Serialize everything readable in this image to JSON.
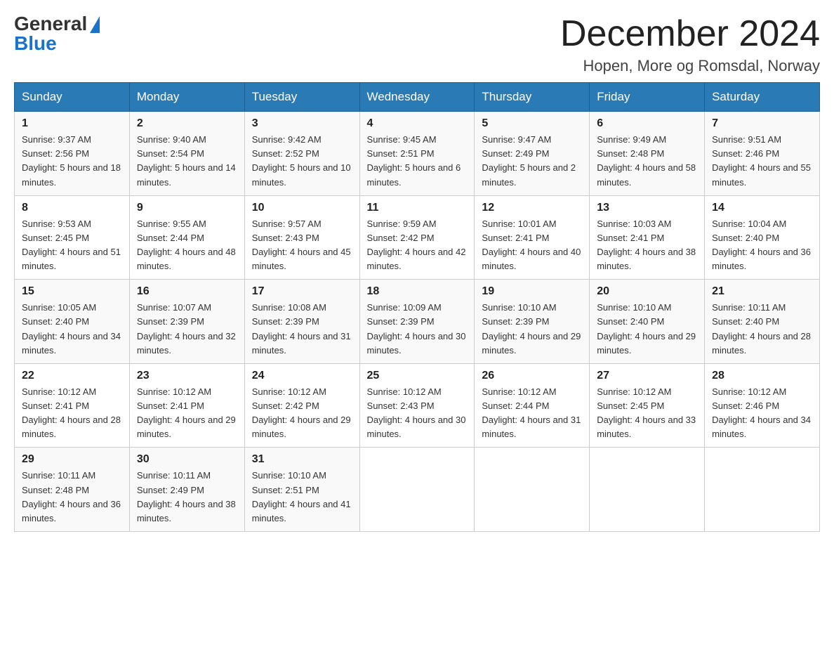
{
  "logo": {
    "general": "General",
    "blue": "Blue"
  },
  "title": "December 2024",
  "subtitle": "Hopen, More og Romsdal, Norway",
  "days_of_week": [
    "Sunday",
    "Monday",
    "Tuesday",
    "Wednesday",
    "Thursday",
    "Friday",
    "Saturday"
  ],
  "weeks": [
    [
      {
        "day": "1",
        "sunrise": "9:37 AM",
        "sunset": "2:56 PM",
        "daylight": "5 hours and 18 minutes."
      },
      {
        "day": "2",
        "sunrise": "9:40 AM",
        "sunset": "2:54 PM",
        "daylight": "5 hours and 14 minutes."
      },
      {
        "day": "3",
        "sunrise": "9:42 AM",
        "sunset": "2:52 PM",
        "daylight": "5 hours and 10 minutes."
      },
      {
        "day": "4",
        "sunrise": "9:45 AM",
        "sunset": "2:51 PM",
        "daylight": "5 hours and 6 minutes."
      },
      {
        "day": "5",
        "sunrise": "9:47 AM",
        "sunset": "2:49 PM",
        "daylight": "5 hours and 2 minutes."
      },
      {
        "day": "6",
        "sunrise": "9:49 AM",
        "sunset": "2:48 PM",
        "daylight": "4 hours and 58 minutes."
      },
      {
        "day": "7",
        "sunrise": "9:51 AM",
        "sunset": "2:46 PM",
        "daylight": "4 hours and 55 minutes."
      }
    ],
    [
      {
        "day": "8",
        "sunrise": "9:53 AM",
        "sunset": "2:45 PM",
        "daylight": "4 hours and 51 minutes."
      },
      {
        "day": "9",
        "sunrise": "9:55 AM",
        "sunset": "2:44 PM",
        "daylight": "4 hours and 48 minutes."
      },
      {
        "day": "10",
        "sunrise": "9:57 AM",
        "sunset": "2:43 PM",
        "daylight": "4 hours and 45 minutes."
      },
      {
        "day": "11",
        "sunrise": "9:59 AM",
        "sunset": "2:42 PM",
        "daylight": "4 hours and 42 minutes."
      },
      {
        "day": "12",
        "sunrise": "10:01 AM",
        "sunset": "2:41 PM",
        "daylight": "4 hours and 40 minutes."
      },
      {
        "day": "13",
        "sunrise": "10:03 AM",
        "sunset": "2:41 PM",
        "daylight": "4 hours and 38 minutes."
      },
      {
        "day": "14",
        "sunrise": "10:04 AM",
        "sunset": "2:40 PM",
        "daylight": "4 hours and 36 minutes."
      }
    ],
    [
      {
        "day": "15",
        "sunrise": "10:05 AM",
        "sunset": "2:40 PM",
        "daylight": "4 hours and 34 minutes."
      },
      {
        "day": "16",
        "sunrise": "10:07 AM",
        "sunset": "2:39 PM",
        "daylight": "4 hours and 32 minutes."
      },
      {
        "day": "17",
        "sunrise": "10:08 AM",
        "sunset": "2:39 PM",
        "daylight": "4 hours and 31 minutes."
      },
      {
        "day": "18",
        "sunrise": "10:09 AM",
        "sunset": "2:39 PM",
        "daylight": "4 hours and 30 minutes."
      },
      {
        "day": "19",
        "sunrise": "10:10 AM",
        "sunset": "2:39 PM",
        "daylight": "4 hours and 29 minutes."
      },
      {
        "day": "20",
        "sunrise": "10:10 AM",
        "sunset": "2:40 PM",
        "daylight": "4 hours and 29 minutes."
      },
      {
        "day": "21",
        "sunrise": "10:11 AM",
        "sunset": "2:40 PM",
        "daylight": "4 hours and 28 minutes."
      }
    ],
    [
      {
        "day": "22",
        "sunrise": "10:12 AM",
        "sunset": "2:41 PM",
        "daylight": "4 hours and 28 minutes."
      },
      {
        "day": "23",
        "sunrise": "10:12 AM",
        "sunset": "2:41 PM",
        "daylight": "4 hours and 29 minutes."
      },
      {
        "day": "24",
        "sunrise": "10:12 AM",
        "sunset": "2:42 PM",
        "daylight": "4 hours and 29 minutes."
      },
      {
        "day": "25",
        "sunrise": "10:12 AM",
        "sunset": "2:43 PM",
        "daylight": "4 hours and 30 minutes."
      },
      {
        "day": "26",
        "sunrise": "10:12 AM",
        "sunset": "2:44 PM",
        "daylight": "4 hours and 31 minutes."
      },
      {
        "day": "27",
        "sunrise": "10:12 AM",
        "sunset": "2:45 PM",
        "daylight": "4 hours and 33 minutes."
      },
      {
        "day": "28",
        "sunrise": "10:12 AM",
        "sunset": "2:46 PM",
        "daylight": "4 hours and 34 minutes."
      }
    ],
    [
      {
        "day": "29",
        "sunrise": "10:11 AM",
        "sunset": "2:48 PM",
        "daylight": "4 hours and 36 minutes."
      },
      {
        "day": "30",
        "sunrise": "10:11 AM",
        "sunset": "2:49 PM",
        "daylight": "4 hours and 38 minutes."
      },
      {
        "day": "31",
        "sunrise": "10:10 AM",
        "sunset": "2:51 PM",
        "daylight": "4 hours and 41 minutes."
      },
      null,
      null,
      null,
      null
    ]
  ]
}
